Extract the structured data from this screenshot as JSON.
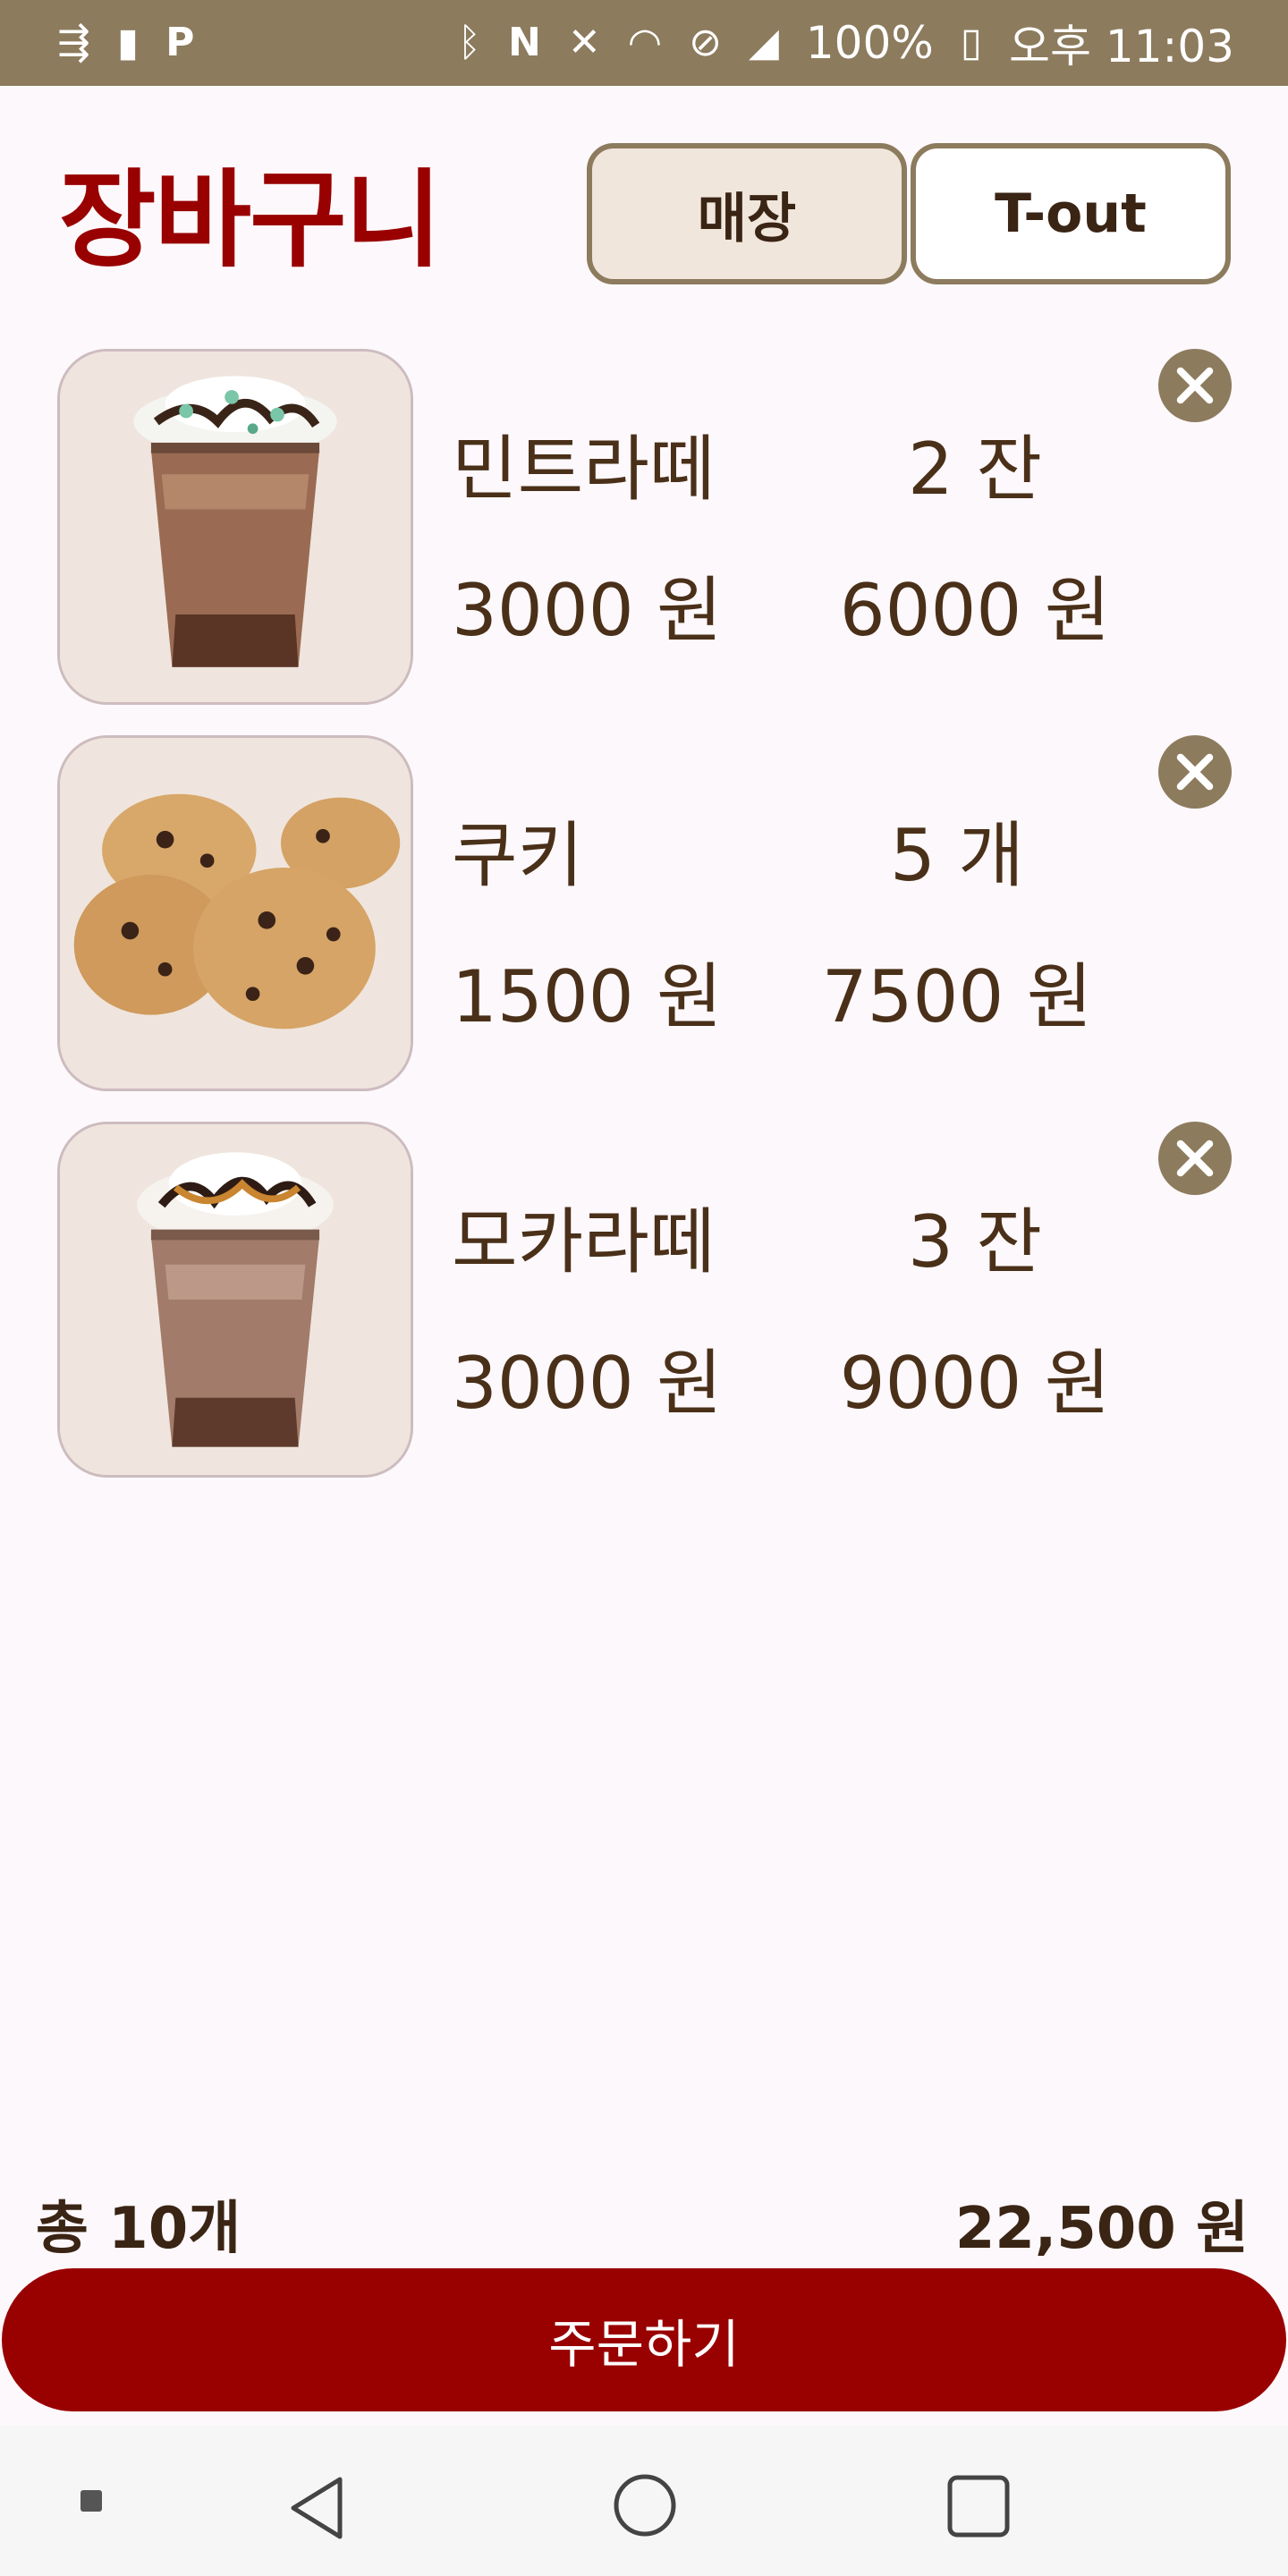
{
  "status_bar": {
    "battery_text": "100%",
    "time_text": "오후 11:03",
    "left_icons": [
      "usb-icon",
      "battery-saver-icon",
      "parking-icon"
    ],
    "right_icons": [
      "bluetooth-icon",
      "nfc-icon",
      "mute-icon",
      "wifi-icon",
      "no-sim-icon",
      "signal-icon",
      "charging-battery-icon"
    ]
  },
  "header": {
    "title": "장바구니",
    "order_type_options": [
      "매장",
      "T-out"
    ],
    "selected_order_type": "매장"
  },
  "cart": {
    "items": [
      {
        "name": "민트라떼",
        "quantity": "2 잔",
        "unit_price": "3000 원",
        "subtotal": "6000 원"
      },
      {
        "name": "쿠키",
        "quantity": "5 개",
        "unit_price": "1500 원",
        "subtotal": "7500 원"
      },
      {
        "name": "모카라떼",
        "quantity": "3 잔",
        "unit_price": "3000 원",
        "subtotal": "9000 원"
      }
    ]
  },
  "summary": {
    "total_count": "총 10개",
    "total_price": "22,500 원"
  },
  "order_button": {
    "label": "주문하기"
  },
  "nav_bar": {
    "icons": [
      "recent-dot-icon",
      "back-icon",
      "home-icon",
      "overview-icon"
    ]
  },
  "colors": {
    "accent": "#990000",
    "brown": "#8c7b5d",
    "text": "#4a3019",
    "background": "#fdf8fb"
  }
}
